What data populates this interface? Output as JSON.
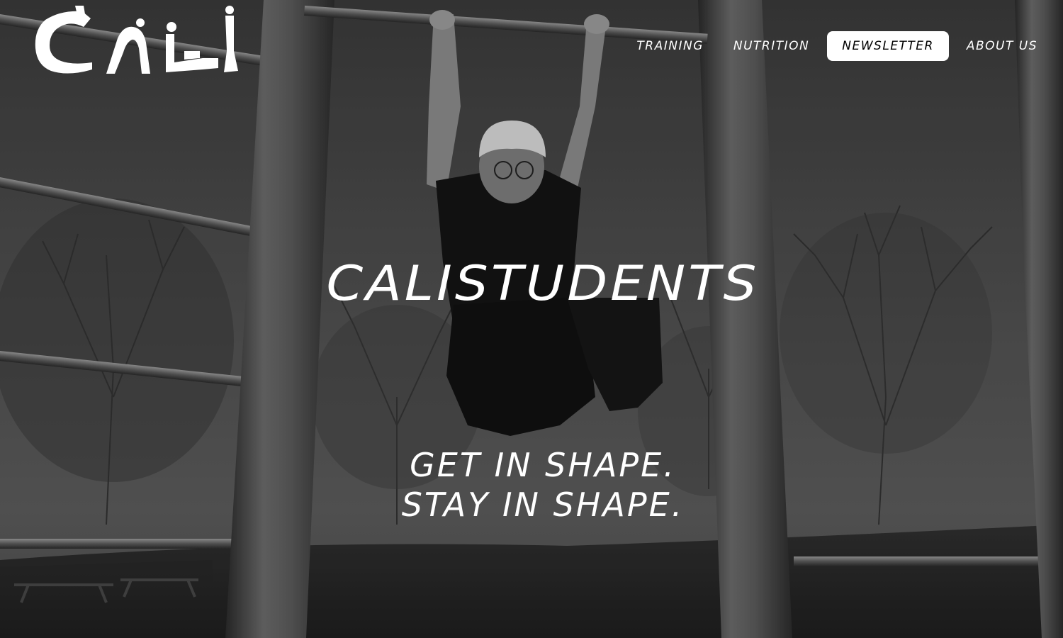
{
  "brand": {
    "logo_text": "CALI"
  },
  "nav": {
    "items": [
      {
        "label": "TRAINING"
      },
      {
        "label": "NUTRITION"
      },
      {
        "label": "NEWSLETTER"
      },
      {
        "label": "ABOUT US"
      }
    ],
    "active_index": 2
  },
  "hero": {
    "title": "CALISTUDENTS",
    "tagline_line1": "GET IN SHAPE.",
    "tagline_line2": "STAY IN SHAPE."
  },
  "colors": {
    "text": "#ffffff",
    "active_bg": "#ffffff",
    "active_text": "#000000"
  }
}
